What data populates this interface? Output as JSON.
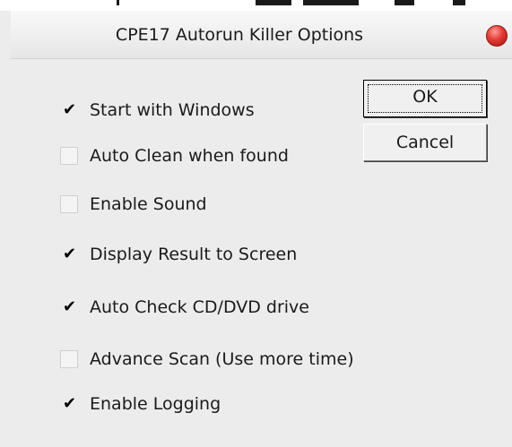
{
  "window": {
    "title": "CPE17 Autorun Killer Options"
  },
  "options": [
    {
      "label": "Start with Windows",
      "checked": true
    },
    {
      "label": "Auto Clean when found",
      "checked": false
    },
    {
      "label": "Enable Sound",
      "checked": false
    },
    {
      "label": "Display Result to Screen",
      "checked": true
    },
    {
      "label": "Auto Check CD/DVD drive",
      "checked": true
    },
    {
      "label": "Advance Scan (Use more time)",
      "checked": false
    },
    {
      "label": "Enable Logging",
      "checked": true
    }
  ],
  "buttons": {
    "ok_label": "OK",
    "cancel_label": "Cancel"
  },
  "colors": {
    "dialog_background": "#ececec",
    "close_button": "#e23a32"
  },
  "icons": {
    "close": "close-icon",
    "check": "check-icon"
  }
}
